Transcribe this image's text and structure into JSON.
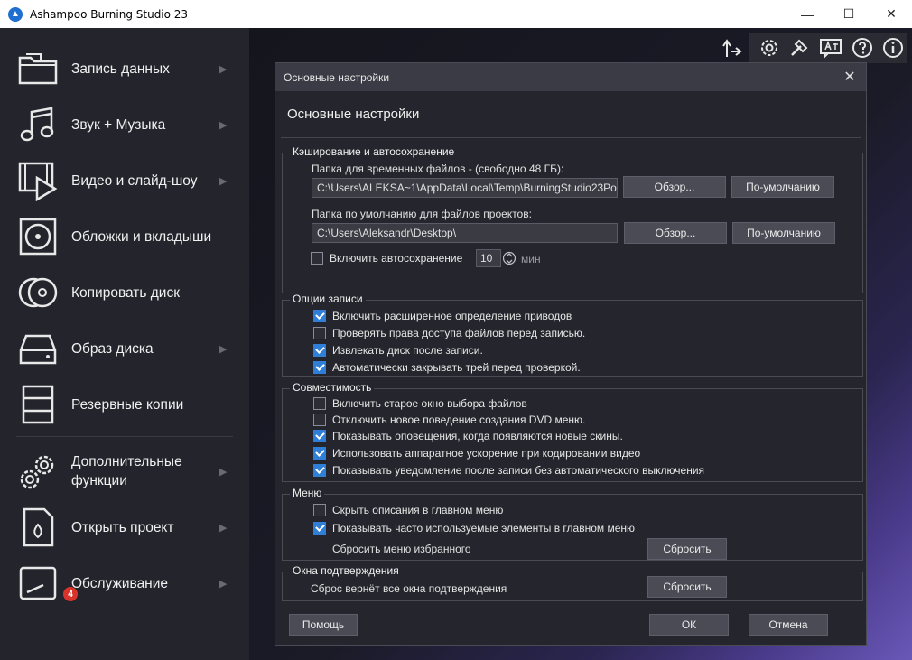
{
  "window": {
    "title": "Ashampoo Burning Studio 23",
    "controls": {
      "minimize": "—",
      "maximize": "☐",
      "close": "✕"
    }
  },
  "sidebar": {
    "items": [
      {
        "label": "Запись данных",
        "icon": "folder-icon",
        "has_arrow": true
      },
      {
        "label": "Звук + Музыка",
        "icon": "music-note-icon",
        "has_arrow": true
      },
      {
        "label": "Видео и слайд-шоу",
        "icon": "film-play-icon",
        "has_arrow": true
      },
      {
        "label": "Обложки и вкладыши",
        "icon": "disc-cover-icon",
        "has_arrow": false
      },
      {
        "label": "Копировать диск",
        "icon": "discs-copy-icon",
        "has_arrow": false
      },
      {
        "label": "Образ диска",
        "icon": "drive-icon",
        "has_arrow": true
      },
      {
        "label": "Резервные копии",
        "icon": "backup-stack-icon",
        "has_arrow": false
      },
      {
        "label_line1": "Дополнительные",
        "label_line2": "функции",
        "icon": "gears-icon",
        "has_arrow": true
      },
      {
        "label": "Открыть проект",
        "icon": "project-file-icon",
        "has_arrow": true
      },
      {
        "label": "Обслуживание",
        "icon": "maintenance-icon",
        "has_arrow": true,
        "badge": "4"
      }
    ],
    "arrow_glyph": "▶"
  },
  "toolbar_icons": [
    "transfer-icon",
    "settings-gear-icon",
    "tools-icon",
    "language-icon",
    "help-icon",
    "info-icon"
  ],
  "dialog": {
    "window_title": "Основные настройки",
    "heading": "Основные настройки",
    "close_glyph": "✕",
    "caching": {
      "title": "Кэширование и автосохранение",
      "temp_folder_label": "Папка для временных файлов - (свободно 48 ГБ):",
      "temp_folder_value": "C:\\Users\\ALEKSA~1\\AppData\\Local\\Temp\\BurningStudio23Po",
      "project_folder_label": "Папка по умолчанию для файлов проектов:",
      "project_folder_value": "C:\\Users\\Aleksandr\\Desktop\\",
      "browse_label": "Обзор...",
      "default_label": "По-умолчанию",
      "autosave_label": "Включить автосохранение",
      "autosave_checked": false,
      "autosave_value": "10",
      "autosave_unit": "мин"
    },
    "record_options": {
      "title": "Опции записи",
      "items": [
        {
          "label": "Включить расширенное определение приводов",
          "checked": true
        },
        {
          "label": "Проверять права доступа файлов перед записью.",
          "checked": false
        },
        {
          "label": "Извлекать диск после записи.",
          "checked": true
        },
        {
          "label": "Автоматически закрывать трей перед проверкой.",
          "checked": true
        }
      ]
    },
    "compatibility": {
      "title": "Совместимость",
      "items": [
        {
          "label": "Включить старое окно выбора файлов",
          "checked": false
        },
        {
          "label": "Отключить новое поведение создания DVD меню.",
          "checked": false
        },
        {
          "label": "Показывать оповещения, когда появляются новые скины.",
          "checked": true
        },
        {
          "label": "Использовать аппаратное ускорение при кодировании видео",
          "checked": true
        },
        {
          "label": "Показывать уведомление после записи без автоматического выключения",
          "checked": true
        }
      ]
    },
    "menu": {
      "title": "Меню",
      "items": [
        {
          "label": "Скрыть описания в главном меню",
          "checked": false
        },
        {
          "label": "Показывать часто используемые элементы в главном меню",
          "checked": true
        }
      ],
      "reset_favorites_label": "Сбросить меню избранного",
      "reset_button": "Сбросить"
    },
    "confirmations": {
      "title": "Окна подтверждения",
      "reset_text": "Сброс вернёт все окна подтверждения",
      "reset_button": "Сбросить"
    },
    "footer": {
      "help": "Помощь",
      "ok": "ОК",
      "cancel": "Отмена"
    }
  }
}
